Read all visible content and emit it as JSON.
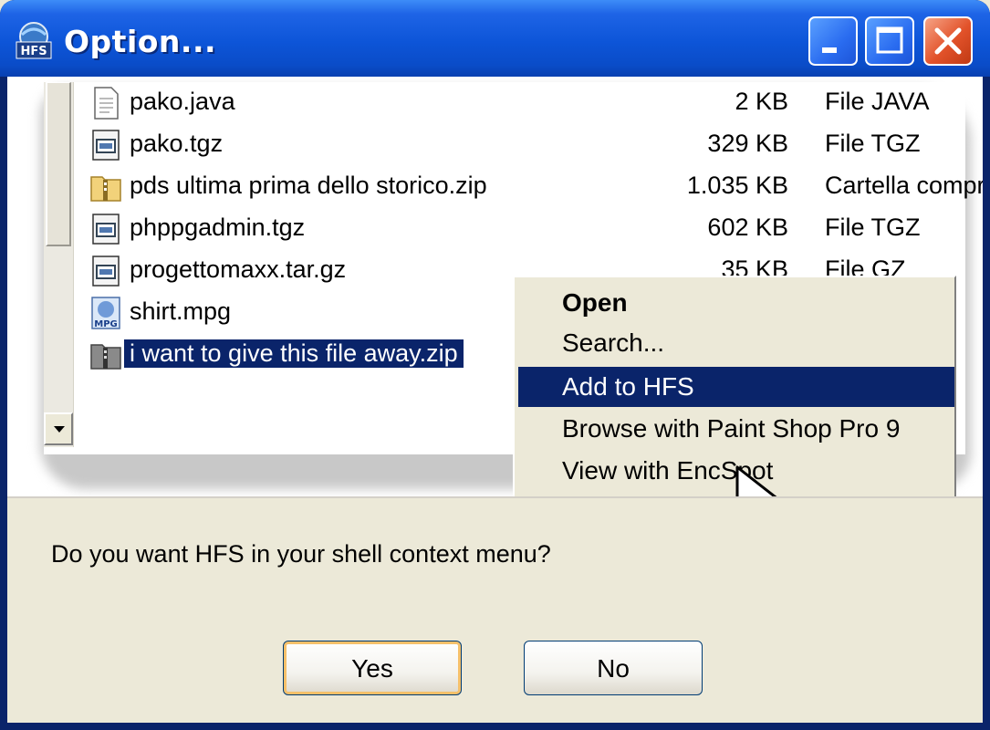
{
  "window": {
    "title": "Option...",
    "controls": {
      "minimize_icon": "minimize-icon",
      "maximize_icon": "maximize-icon",
      "close_icon": "close-icon"
    },
    "app_icon": {
      "icon": "hfs-app-icon",
      "label": "HFS"
    }
  },
  "preview": {
    "files": [
      {
        "name": "pako.java",
        "size": "2 KB",
        "type": "File JAVA",
        "icon": "text-file-icon"
      },
      {
        "name": "pako.tgz",
        "size": "329 KB",
        "type": "File TGZ",
        "icon": "archive-file-icon"
      },
      {
        "name": "pds ultima prima dello storico.zip",
        "size": "1.035 KB",
        "type": "Cartella compr",
        "icon": "zip-folder-icon"
      },
      {
        "name": "phppgadmin.tgz",
        "size": "602 KB",
        "type": "File TGZ",
        "icon": "archive-file-icon"
      },
      {
        "name": "progettomaxx.tar.gz",
        "size": "35 KB",
        "type": "File GZ",
        "icon": "archive-file-icon"
      },
      {
        "name": "shirt.mpg",
        "size": "",
        "type": "",
        "icon": "mpg-file-icon",
        "icon_label": "MPG"
      },
      {
        "name": "i want to give this file away.zip",
        "size": "",
        "type": "",
        "icon": "zip-folder-icon",
        "selected": true
      }
    ],
    "context_menu": [
      {
        "label": "Open",
        "bold": true
      },
      {
        "label": "Search..."
      },
      {
        "label": "Add to HFS",
        "highlighted": true
      },
      {
        "label": "Browse with Paint Shop Pro 9"
      },
      {
        "label": "View with EncSpot"
      }
    ]
  },
  "dialog": {
    "question": "Do you want HFS in your shell context menu?",
    "yes_label": "Yes",
    "no_label": "No"
  },
  "colors": {
    "titlebar": "#0a55d8",
    "selection": "#0a246a",
    "dialog_bg": "#ece9d8"
  }
}
